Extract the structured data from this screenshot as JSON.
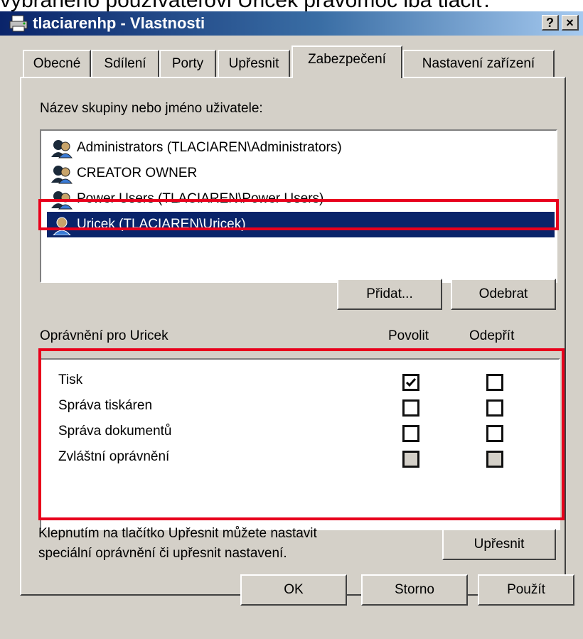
{
  "caption": "vybraného používateľovi Uricek právomoc iba tlačiť.",
  "window": {
    "title": "tlaciarenhp - Vlastnosti",
    "help_label": "?",
    "close_label": "×"
  },
  "tabs": [
    {
      "label": "Obecné"
    },
    {
      "label": "Sdílení"
    },
    {
      "label": "Porty"
    },
    {
      "label": "Upřesnit"
    },
    {
      "label": "Zabezpečení",
      "active": true
    },
    {
      "label": "Nastavení zařízení"
    }
  ],
  "users": {
    "label": "Název skupiny nebo jméno uživatele:",
    "items": [
      {
        "name": "Administrators (TLACIAREN\\Administrators)",
        "icon": "group-icon"
      },
      {
        "name": "CREATOR OWNER",
        "icon": "group-icon"
      },
      {
        "name": "Power Users (TLACIAREN\\Power Users)",
        "icon": "group-icon"
      },
      {
        "name": "Uricek (TLACIAREN\\Uricek)",
        "icon": "user-icon",
        "selected": true
      }
    ],
    "add_label": "Přidat...",
    "remove_label": "Odebrat"
  },
  "permissions": {
    "label": "Oprávnění pro Uricek",
    "allow_header": "Povolit",
    "deny_header": "Odepřít",
    "items": [
      {
        "name": "Tisk",
        "allow": true,
        "deny": false,
        "disabled": false
      },
      {
        "name": "Správa tiskáren",
        "allow": false,
        "deny": false,
        "disabled": false
      },
      {
        "name": "Správa dokumentů",
        "allow": false,
        "deny": false,
        "disabled": false
      },
      {
        "name": "Zvláštní oprávnění",
        "allow": false,
        "deny": false,
        "disabled": true
      }
    ]
  },
  "advanced": {
    "hint_line1": "Klepnutím na tlačítko Upřesnit můžete nastavit",
    "hint_line2": "speciální oprávnění či upřesnit nastavení.",
    "button_label": "Upřesnit"
  },
  "footer": {
    "ok_label": "OK",
    "cancel_label": "Storno",
    "apply_label": "Použít"
  },
  "colors": {
    "highlight": "#e8001c",
    "selection": "#0a246a",
    "dialog_bg": "#d4d0c8"
  }
}
